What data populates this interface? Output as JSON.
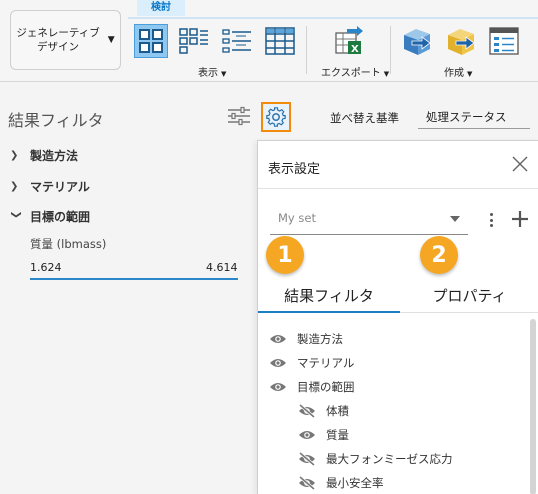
{
  "toolbar": {
    "workspace": {
      "label": "ジェネレーティブ\nデザイン"
    },
    "active_tab": "検討",
    "groups": {
      "display": "表示",
      "export": "エクスポート",
      "create": "作成"
    }
  },
  "left_panel": {
    "title": "結果フィルタ",
    "categories": [
      {
        "label": "製造方法",
        "expanded": false
      },
      {
        "label": "マテリアル",
        "expanded": false
      },
      {
        "label": "目標の範囲",
        "expanded": true
      }
    ],
    "range": {
      "name": "質量 (lbmass)",
      "min": "1.624",
      "max": "4.614"
    }
  },
  "top_tabs": {
    "sort": "並べ替え基準",
    "status": "処理ステータス"
  },
  "display_settings": {
    "title": "表示設定",
    "set_value": "My set",
    "badges": [
      "1",
      "2"
    ],
    "tabs": {
      "filter": "結果フィルタ",
      "properties": "プロパティ"
    },
    "items": [
      {
        "label": "製造方法",
        "visible": true
      },
      {
        "label": "マテリアル",
        "visible": true
      },
      {
        "label": "目標の範囲",
        "visible": true
      },
      {
        "label": "体積",
        "visible": false
      },
      {
        "label": "質量",
        "visible": true
      },
      {
        "label": "最大フォンミーゼス応力",
        "visible": false
      },
      {
        "label": "最小安全率",
        "visible": false
      }
    ]
  },
  "colors": {
    "accent": "#1b7fc4",
    "badge": "#f5a623",
    "highlight_border": "#f28b0c"
  }
}
